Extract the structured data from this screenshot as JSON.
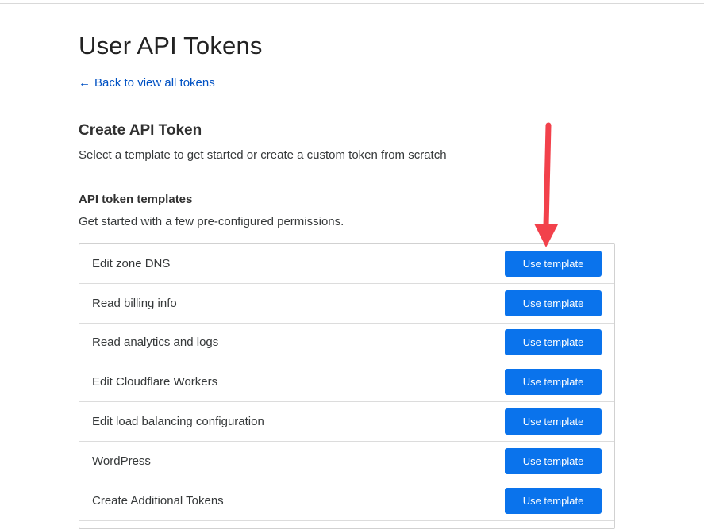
{
  "page": {
    "title": "User API Tokens",
    "back_link": "Back to view all tokens"
  },
  "create": {
    "title": "Create API Token",
    "description": "Select a template to get started or create a custom token from scratch"
  },
  "templates": {
    "title": "API token templates",
    "description": "Get started with a few pre-configured permissions.",
    "items": [
      {
        "name": "Edit zone DNS",
        "button": "Use template"
      },
      {
        "name": "Read billing info",
        "button": "Use template"
      },
      {
        "name": "Read analytics and logs",
        "button": "Use template"
      },
      {
        "name": "Edit Cloudflare Workers",
        "button": "Use template"
      },
      {
        "name": "Edit load balancing configuration",
        "button": "Use template"
      },
      {
        "name": "WordPress",
        "button": "Use template"
      },
      {
        "name": "Create Additional Tokens",
        "button": "Use template"
      }
    ]
  },
  "icons": {
    "back": "arrow-left-icon",
    "annotation": "red-down-arrow-annotation"
  },
  "colors": {
    "link": "#0051c3",
    "button": "#0a73ec",
    "annotation": "#f2414b"
  }
}
